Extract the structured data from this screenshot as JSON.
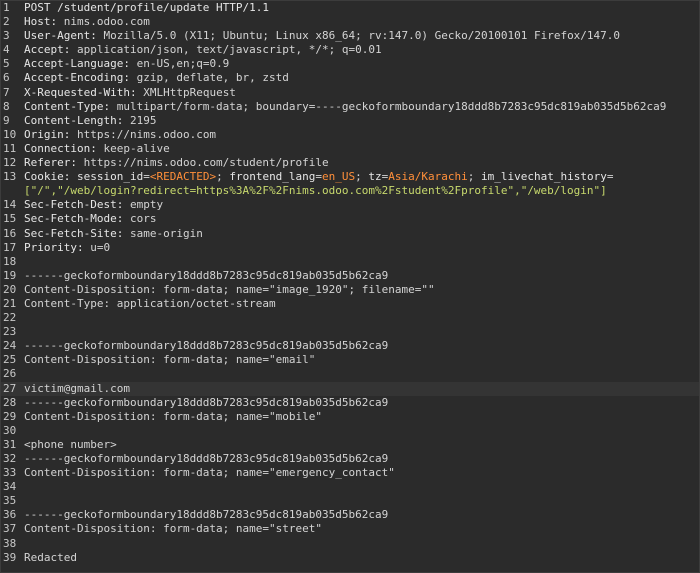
{
  "request": {
    "lines": [
      {
        "n": "1",
        "segments": [
          {
            "t": "POST /student/profile/update HTTP/1.1",
            "c": "k"
          }
        ]
      },
      {
        "n": "2",
        "segments": [
          {
            "t": "Host: ",
            "c": "k"
          },
          {
            "t": "nims.odoo.com",
            "c": "v"
          }
        ]
      },
      {
        "n": "3",
        "segments": [
          {
            "t": "User-Agent: ",
            "c": "k"
          },
          {
            "t": "Mozilla/5.0 (X11; Ubuntu; Linux x86_64; rv:147.0) Gecko/20100101 Firefox/147.0",
            "c": "v"
          }
        ]
      },
      {
        "n": "4",
        "segments": [
          {
            "t": "Accept: ",
            "c": "k"
          },
          {
            "t": "application/json, text/javascript, */*; q=0.01",
            "c": "v"
          }
        ]
      },
      {
        "n": "5",
        "segments": [
          {
            "t": "Accept-Language: ",
            "c": "k"
          },
          {
            "t": "en-US,en;q=0.9",
            "c": "v"
          }
        ]
      },
      {
        "n": "6",
        "segments": [
          {
            "t": "Accept-Encoding: ",
            "c": "k"
          },
          {
            "t": "gzip, deflate, br, zstd",
            "c": "v"
          }
        ]
      },
      {
        "n": "7",
        "segments": [
          {
            "t": "X-Requested-With: ",
            "c": "k"
          },
          {
            "t": "XMLHttpRequest",
            "c": "v"
          }
        ]
      },
      {
        "n": "8",
        "segments": [
          {
            "t": "Content-Type: ",
            "c": "k"
          },
          {
            "t": "multipart/form-data; boundary=----geckoformboundary18ddd8b7283c95dc819ab035d5b62ca9",
            "c": "v"
          }
        ]
      },
      {
        "n": "9",
        "segments": [
          {
            "t": "Content-Length: ",
            "c": "k"
          },
          {
            "t": "2195",
            "c": "v"
          }
        ]
      },
      {
        "n": "10",
        "segments": [
          {
            "t": "Origin: ",
            "c": "k"
          },
          {
            "t": "https://nims.odoo.com",
            "c": "v"
          }
        ]
      },
      {
        "n": "11",
        "segments": [
          {
            "t": "Connection: ",
            "c": "k"
          },
          {
            "t": "keep-alive",
            "c": "v"
          }
        ]
      },
      {
        "n": "12",
        "segments": [
          {
            "t": "Referer: ",
            "c": "k"
          },
          {
            "t": "https://nims.odoo.com/student/profile",
            "c": "v"
          }
        ]
      },
      {
        "n": "13",
        "segments": [
          {
            "t": "Cookie: ",
            "c": "k"
          },
          {
            "t": "session_id",
            "c": "ck-name"
          },
          {
            "t": "=",
            "c": "v"
          },
          {
            "t": "<REDACTED>",
            "c": "ck-val"
          },
          {
            "t": "; ",
            "c": "v"
          },
          {
            "t": "frontend_lang",
            "c": "ck-name"
          },
          {
            "t": "=",
            "c": "v"
          },
          {
            "t": "en_US",
            "c": "ck-val"
          },
          {
            "t": "; ",
            "c": "v"
          },
          {
            "t": "tz",
            "c": "ck-name"
          },
          {
            "t": "=",
            "c": "v"
          },
          {
            "t": "Asia/Karachi",
            "c": "ck-val"
          },
          {
            "t": "; ",
            "c": "v"
          },
          {
            "t": "im_livechat_history",
            "c": "ck-name"
          },
          {
            "t": "=",
            "c": "v"
          }
        ]
      },
      {
        "n": "",
        "segments": [
          {
            "t": "[\"/\",\"/web/login?redirect=https%3A%2F%2Fnims.odoo.com%2Fstudent%2Fprofile\",\"/web/login\"]",
            "c": "ck-text"
          }
        ]
      },
      {
        "n": "14",
        "segments": [
          {
            "t": "Sec-Fetch-Dest: ",
            "c": "k"
          },
          {
            "t": "empty",
            "c": "v"
          }
        ]
      },
      {
        "n": "15",
        "segments": [
          {
            "t": "Sec-Fetch-Mode: ",
            "c": "k"
          },
          {
            "t": "cors",
            "c": "v"
          }
        ]
      },
      {
        "n": "16",
        "segments": [
          {
            "t": "Sec-Fetch-Site: ",
            "c": "k"
          },
          {
            "t": "same-origin",
            "c": "v"
          }
        ]
      },
      {
        "n": "17",
        "segments": [
          {
            "t": "Priority: ",
            "c": "k"
          },
          {
            "t": "u=0",
            "c": "v"
          }
        ]
      },
      {
        "n": "18",
        "segments": []
      },
      {
        "n": "19",
        "segments": [
          {
            "t": "------geckoformboundary18ddd8b7283c95dc819ab035d5b62ca9",
            "c": "v"
          }
        ]
      },
      {
        "n": "20",
        "segments": [
          {
            "t": "Content-Disposition: form-data; name=\"image_1920\"; filename=\"\"",
            "c": "v"
          }
        ]
      },
      {
        "n": "21",
        "segments": [
          {
            "t": "Content-Type: application/octet-stream",
            "c": "v"
          }
        ]
      },
      {
        "n": "22",
        "segments": []
      },
      {
        "n": "23",
        "segments": []
      },
      {
        "n": "24",
        "segments": [
          {
            "t": "------geckoformboundary18ddd8b7283c95dc819ab035d5b62ca9",
            "c": "v"
          }
        ]
      },
      {
        "n": "25",
        "segments": [
          {
            "t": "Content-Disposition: form-data; name=\"email\"",
            "c": "v"
          }
        ]
      },
      {
        "n": "26",
        "segments": []
      },
      {
        "n": "27",
        "active": true,
        "segments": [
          {
            "t": "victim@gmail.com",
            "c": "v"
          }
        ]
      },
      {
        "n": "28",
        "segments": [
          {
            "t": "------geckoformboundary18ddd8b7283c95dc819ab035d5b62ca9",
            "c": "v"
          }
        ]
      },
      {
        "n": "29",
        "segments": [
          {
            "t": "Content-Disposition: form-data; name=\"mobile\"",
            "c": "v"
          }
        ]
      },
      {
        "n": "30",
        "segments": []
      },
      {
        "n": "31",
        "segments": [
          {
            "t": "<phone number>",
            "c": "v"
          }
        ]
      },
      {
        "n": "32",
        "segments": [
          {
            "t": "------geckoformboundary18ddd8b7283c95dc819ab035d5b62ca9",
            "c": "v"
          }
        ]
      },
      {
        "n": "33",
        "segments": [
          {
            "t": "Content-Disposition: form-data; name=\"emergency_contact\"",
            "c": "v"
          }
        ]
      },
      {
        "n": "34",
        "segments": []
      },
      {
        "n": "35",
        "segments": []
      },
      {
        "n": "36",
        "segments": [
          {
            "t": "------geckoformboundary18ddd8b7283c95dc819ab035d5b62ca9",
            "c": "v"
          }
        ]
      },
      {
        "n": "37",
        "segments": [
          {
            "t": "Content-Disposition: form-data; name=\"street\"",
            "c": "v"
          }
        ]
      },
      {
        "n": "38",
        "segments": []
      },
      {
        "n": "39",
        "segments": [
          {
            "t": "Redacted",
            "c": "v"
          }
        ]
      }
    ]
  },
  "colors": {
    "background": "#2b2b2b",
    "text": "#d4d4d4",
    "cookie_value": "#ff8f3a",
    "cookie_json": "#c7d96d",
    "active_line": "#343434"
  }
}
